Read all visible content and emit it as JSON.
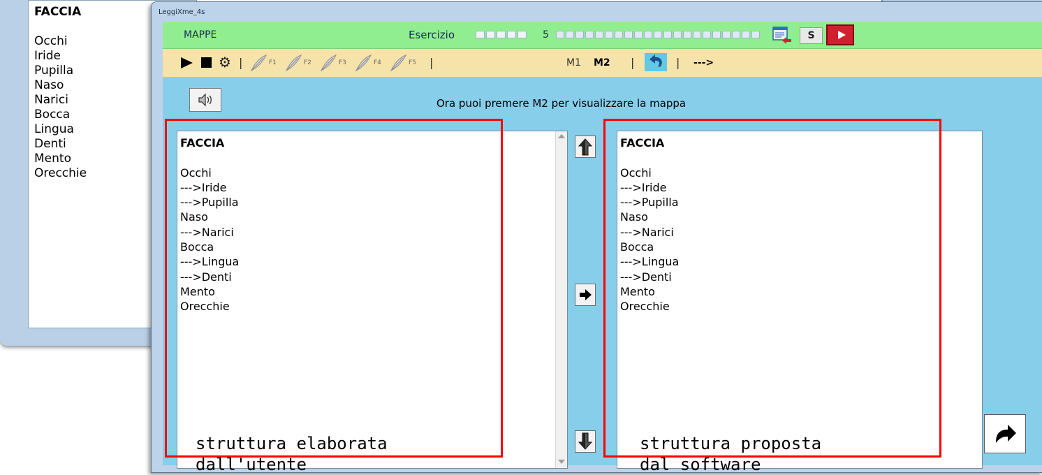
{
  "background_window": {
    "title": "FACCIA",
    "items": [
      "Occhi",
      "Iride",
      "Pupilla",
      "Naso",
      "Narici",
      "Bocca",
      "Lingua",
      "Denti",
      "Mento",
      "Orecchie"
    ]
  },
  "window": {
    "title": "LeggiXme_4s"
  },
  "green_bar": {
    "section": "MAPPE",
    "exercise_label": "Esercizio",
    "exercise_number": "5",
    "s_button": "S"
  },
  "toolbar": {
    "f_keys": [
      "F1",
      "F2",
      "F3",
      "F4",
      "F5"
    ],
    "separator": "|",
    "m1": "M1",
    "m2": "M2",
    "arrow": "--->"
  },
  "message": "Ora puoi premere M2 per visualizzare la mappa",
  "user_list": {
    "title": "FACCIA",
    "items": [
      "Occhi",
      "--->Iride",
      "--->Pupilla",
      "Naso",
      "--->Narici",
      "Bocca",
      "--->Lingua",
      "--->Denti",
      "Mento",
      "Orecchie"
    ]
  },
  "proposed_list": {
    "title": "FACCIA",
    "items": [
      "Occhi",
      "--->Iride",
      "--->Pupilla",
      "Naso",
      "--->Narici",
      "Bocca",
      "--->Lingua",
      "--->Denti",
      "Mento",
      "Orecchie"
    ]
  },
  "annotations": {
    "left_line1": "struttura elaborata",
    "left_line2": "dall'utente",
    "right_line1": "struttura proposta",
    "right_line2": "dal software"
  },
  "colors": {
    "green_bar": "#90ee90",
    "toolbar": "#f6e3a9",
    "client": "#87ceeb",
    "highlight": "#ff0000"
  }
}
